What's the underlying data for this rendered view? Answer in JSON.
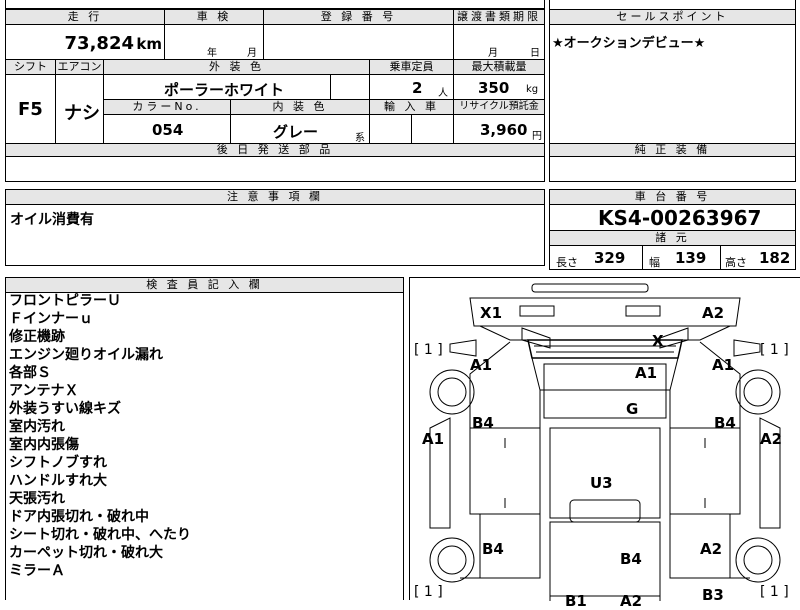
{
  "top_row": {
    "mileage_header": "走 行",
    "inspection_header": "車 検",
    "registration_header": "登 録 番 号",
    "transfer_header": "譲渡書類期限",
    "sales_point_header": "セールスポイント"
  },
  "vehicle": {
    "mileage": "73,824",
    "mileage_unit": "km",
    "inspection_year_unit": "年",
    "inspection_month_unit": "月",
    "transfer_month_unit": "月",
    "transfer_day_unit": "日",
    "shift_header": "シフト",
    "aircon_header": "エアコン",
    "exterior_header": "外 装 色",
    "capacity_header": "乗車定員",
    "max_load_header": "最大積載量",
    "shift": "F5",
    "aircon": "ナシ",
    "exterior_color": "ポーラーホワイト",
    "capacity": "2",
    "capacity_unit": "人",
    "max_load": "350",
    "max_load_unit": "kg",
    "color_no_header": "カラーNo.",
    "interior_header": "内 装 色",
    "import_header": "輸 入 車",
    "recycle_header": "リサイクル預託金",
    "color_no": "054",
    "interior_color": "グレー",
    "interior_suffix": "系",
    "recycle_fee": "3,960",
    "recycle_unit": "円",
    "later_parts_header": "後 日 発 送 部 品",
    "genuine_header": "純 正 装 備"
  },
  "sales_point": "★オークションデビュー★",
  "caution": {
    "header": "注 意 事 項 欄",
    "text": "オイル消費有"
  },
  "chassis": {
    "header": "車 台 番 号",
    "number": "KS4-00263967",
    "dims_header": "諸 元",
    "length_label": "長さ",
    "length": "329",
    "width_label": "幅",
    "width": "139",
    "height_label": "高さ",
    "height": "182"
  },
  "inspector": {
    "header": "検 査 員 記 入 欄",
    "notes": [
      "フロントピラーＵ",
      "Ｆインナーｕ",
      "修正機跡",
      "エンジン廻りオイル漏れ",
      "各部Ｓ",
      "アンテナＸ",
      "外装うすい線キズ",
      "室内汚れ",
      "室内内張傷",
      "シフトノブすれ",
      "ハンドルすれ大",
      "天張汚れ",
      "ドア内張切れ・破れ中",
      "シート切れ・破れ中、へたり",
      "カーペット切れ・破れ大",
      "ミラーＡ"
    ]
  },
  "diagram": {
    "bracket_tl": "[ 1 ]",
    "bracket_tr": "[ 1 ]",
    "bracket_bl": "[ 1 ]",
    "bracket_br": "[ 1 ]",
    "marks": {
      "x1": "X1",
      "a2_top": "A2",
      "x_roof": "X",
      "a1_left": "A1",
      "a1_center": "A1",
      "a1_right": "A1",
      "g": "G",
      "b4_left": "B4",
      "b4_right": "B4",
      "a1_side": "A1",
      "a2_side": "A2",
      "u3": "U3",
      "b4_lower_left": "B4",
      "b4_lower_center": "B4",
      "a2_lower_right": "A2",
      "b1": "B1",
      "a2_bottom": "A2",
      "b3": "B3"
    }
  }
}
